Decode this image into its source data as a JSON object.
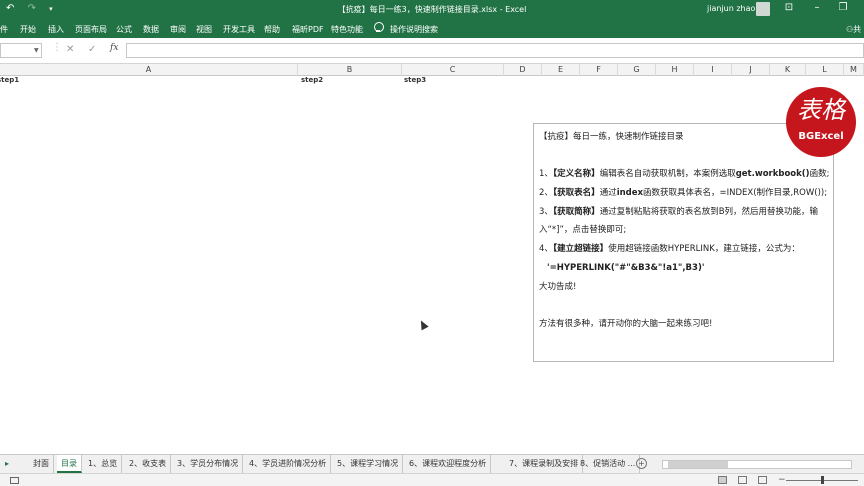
{
  "window": {
    "title": "【抗疫】每日一练3，快速制作链接目录.xlsx - Excel",
    "user": "jianjun zhao",
    "undo_icon": "undo-icon",
    "redo_icon": "redo-icon"
  },
  "ribbon": {
    "tabs": [
      "件",
      "开始",
      "插入",
      "页面布局",
      "公式",
      "数据",
      "审阅",
      "视图",
      "开发工具",
      "帮助",
      "福昕PDF",
      "特色功能"
    ],
    "tell_me": "操作说明搜索",
    "share": "共"
  },
  "formula_bar": {
    "fx_label": "fx",
    "cancel_icon": "close-icon",
    "enter_icon": "check-icon"
  },
  "columns": [
    "A",
    "B",
    "C",
    "D",
    "E",
    "F",
    "G",
    "H",
    "I",
    "J",
    "K",
    "L",
    "M"
  ],
  "cells": {
    "a1": "step1",
    "b1": "step2",
    "c1": "step3"
  },
  "textbox": {
    "title": "【抗疫】每日一练，快速制作链接目录",
    "s1_num": "1、",
    "s1_bold": "【定义名称】",
    "s1_text": "编辑表名自动获取机制，本案例选取",
    "s1_func": "get.workbook()",
    "s1_end": "函数;",
    "s2_num": "2、",
    "s2_bold": "【获取表名】",
    "s2_text": "通过",
    "s2_func": "index",
    "s2_end": "函数获取具体表名，=INDEX(制作目录,ROW());",
    "s3_num": "3、",
    "s3_bold": "【获取简称】",
    "s3_text": "通过复制粘贴将获取的表名放到B列，然后用替换功能，输",
    "s3_cont": "入“*]”，点击替换即可;",
    "s4_num": "4、",
    "s4_bold": "【建立超链接】",
    "s4_text": "使用超链接函数HYPERLINK，建立链接，公式为：",
    "s4_formula": "'=HYPERLINK(\"#\"&B3&\"!a1\",B3)'",
    "done": "大功告成!",
    "footer": "方法有很多种，请开动你的大脑一起来练习吧!"
  },
  "logo": {
    "glyph": "表格",
    "brand": "BGExcel"
  },
  "sheet_tabs": [
    "封面",
    "目录",
    "1、总览",
    "2、收支表",
    "3、学员分布情况",
    "4、学员进阶情况分析",
    "5、课程学习情况",
    "6、课程欢迎程度分析",
    "7、课程录制及安排",
    "8、促销活动 ..."
  ],
  "active_sheet": "目录",
  "colors": {
    "excel_green": "#217346",
    "logo_red": "#c4161c"
  }
}
